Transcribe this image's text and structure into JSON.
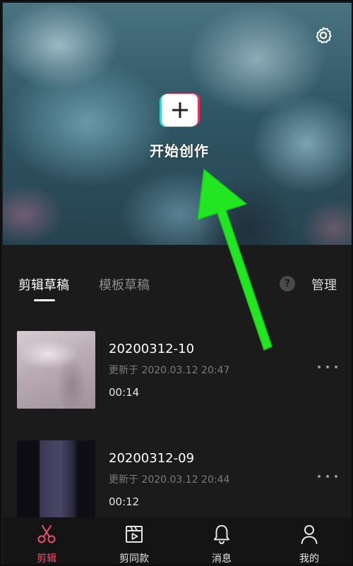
{
  "hero": {
    "create_label": "开始创作",
    "settings_icon": "gear-icon",
    "create_icon": "plus-icon"
  },
  "tabs": {
    "items": [
      {
        "label": "剪辑草稿",
        "active": true
      },
      {
        "label": "模板草稿",
        "active": false
      }
    ],
    "help_label": "?",
    "manage_label": "管理"
  },
  "drafts": [
    {
      "name": "20200312-10",
      "updated": "更新于 2020.03.12 20:47",
      "duration": "00:14"
    },
    {
      "name": "20200312-09",
      "updated": "更新于 2020.03.12 20:44",
      "duration": "00:12"
    }
  ],
  "bottom_nav": [
    {
      "label": "剪辑",
      "icon": "scissors-icon",
      "active": true
    },
    {
      "label": "剪同款",
      "icon": "clapperboard-icon",
      "active": false
    },
    {
      "label": "消息",
      "icon": "bell-icon",
      "active": false
    },
    {
      "label": "我的",
      "icon": "person-icon",
      "active": false
    }
  ],
  "colors": {
    "accent": "#f0506e",
    "background": "#1b1b1b",
    "annotation_arrow": "#22e622",
    "logo_cyan": "#2fd6d8",
    "logo_red": "#f0305a"
  }
}
